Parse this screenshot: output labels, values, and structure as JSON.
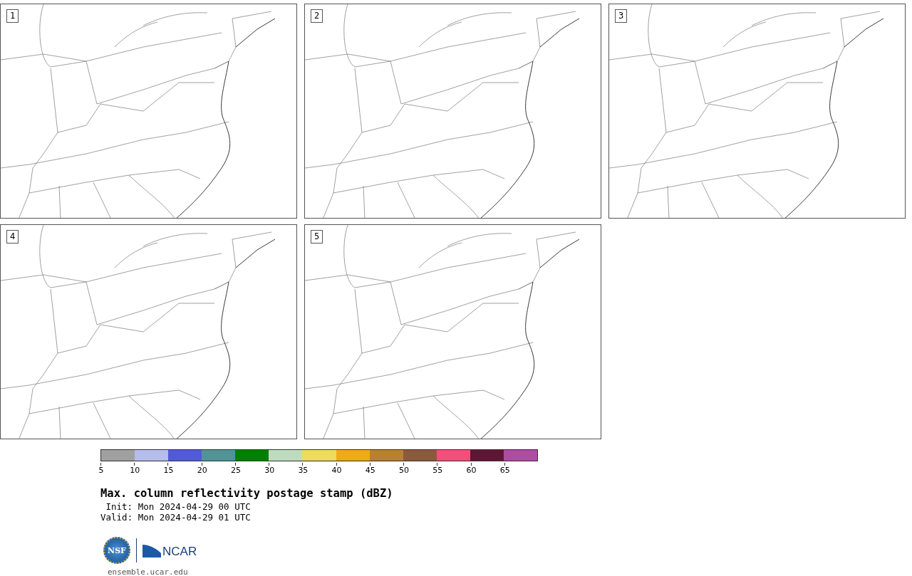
{
  "panels": [
    {
      "label": "1"
    },
    {
      "label": "2"
    },
    {
      "label": "3"
    },
    {
      "label": "4"
    },
    {
      "label": "5"
    }
  ],
  "colorbar": {
    "segments": [
      {
        "color": "#a0a0a0"
      },
      {
        "color": "#b4bdeb"
      },
      {
        "color": "#515ad8"
      },
      {
        "color": "#4f9598"
      },
      {
        "color": "#008000"
      },
      {
        "color": "#bddcbd"
      },
      {
        "color": "#eedb5c"
      },
      {
        "color": "#eeab16"
      },
      {
        "color": "#bb802f"
      },
      {
        "color": "#8b5a3d"
      },
      {
        "color": "#f44e7a"
      },
      {
        "color": "#5f1635"
      },
      {
        "color": "#ad4ca3"
      }
    ],
    "ticks": [
      "5",
      "10",
      "15",
      "20",
      "25",
      "30",
      "35",
      "40",
      "45",
      "50",
      "55",
      "60",
      "65"
    ]
  },
  "title": "Max. column reflectivity postage stamp (dBZ)",
  "init": "Init: Mon 2024-04-29 00 UTC",
  "valid": "Valid: Mon 2024-04-29 01 UTC",
  "logos": {
    "seal": "NSF",
    "wordmark": "NCAR"
  },
  "url": "ensemble.ucar.edu"
}
